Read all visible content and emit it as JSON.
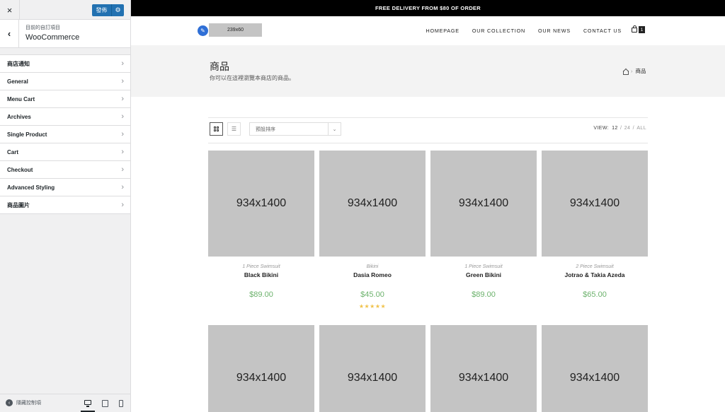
{
  "sidebar": {
    "close_icon": "×",
    "publish_label": "發佈",
    "back_icon": "‹",
    "breadcrumb": "目前的自訂項目",
    "section_title": "WooCommerce",
    "items": [
      {
        "label": "商店通知"
      },
      {
        "label": "General"
      },
      {
        "label": "Menu Cart"
      },
      {
        "label": "Archives"
      },
      {
        "label": "Single Product"
      },
      {
        "label": "Cart"
      },
      {
        "label": "Checkout"
      },
      {
        "label": "Advanced Styling"
      },
      {
        "label": "商品圖片"
      }
    ],
    "chevron": "›",
    "collapse_label": "隱藏控制項",
    "collapse_icon": "‹",
    "devices": [
      "desktop",
      "tablet",
      "mobile"
    ],
    "active_device": "desktop"
  },
  "preview": {
    "topbar_text": "FREE DELIVERY FROM $80 OF ORDER",
    "logo_placeholder": "239x60",
    "nav": [
      {
        "label": "HOMEPAGE"
      },
      {
        "label": "OUR COLLECTION"
      },
      {
        "label": "OUR NEWS"
      },
      {
        "label": "CONTACT US"
      }
    ],
    "cart_count": "1",
    "page_title": "商品",
    "page_subtitle": "你可以在這裡瀏覽本商店的商品。",
    "breadcrumb_current": "商品",
    "sort_value": "預設排序",
    "view_label": "VIEW:",
    "view_options": [
      "12",
      "24",
      "ALL"
    ],
    "view_current": "12",
    "products": [
      {
        "image": "934x1400",
        "category": "1 Piece Swimsuit",
        "name": "Black Bikini",
        "price": "$89.00",
        "rating": 0
      },
      {
        "image": "934x1400",
        "category": "Bikini",
        "name": "Dasia Romeo",
        "price": "$45.00",
        "rating": 5
      },
      {
        "image": "934x1400",
        "category": "1 Piece Swimsuit",
        "name": "Green Bikini",
        "price": "$89.00",
        "rating": 0
      },
      {
        "image": "934x1400",
        "category": "2 Piece Swimsuit",
        "name": "Jotrao & Takia Azeda",
        "price": "$65.00",
        "rating": 0
      },
      {
        "image": "934x1400"
      },
      {
        "image": "934x1400"
      },
      {
        "image": "934x1400"
      },
      {
        "image": "934x1400"
      }
    ]
  },
  "colors": {
    "publish_button": "#2271b1",
    "price": "#6cb26c",
    "stars": "#f0c24a",
    "placeholder": "#c4c4c4",
    "topbar": "#000000"
  }
}
